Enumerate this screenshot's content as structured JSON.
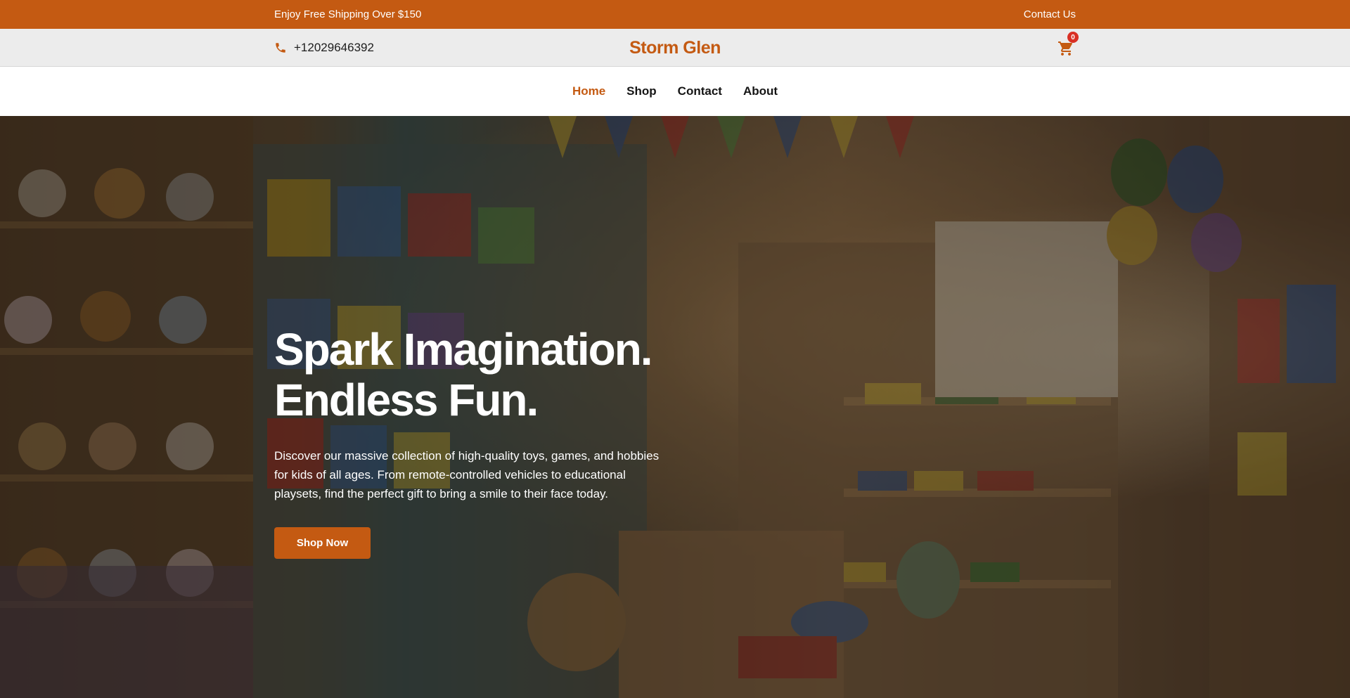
{
  "topbar": {
    "promo_text": "Enjoy Free Shipping Over $150",
    "contact_link": "Contact Us"
  },
  "header": {
    "phone": "+12029646392",
    "brand": "Storm Glen",
    "cart_count": "0"
  },
  "nav": {
    "items": [
      {
        "label": "Home",
        "active": true
      },
      {
        "label": "Shop",
        "active": false
      },
      {
        "label": "Contact",
        "active": false
      },
      {
        "label": "About",
        "active": false
      }
    ]
  },
  "hero": {
    "title_line1": "Spark Imagination.",
    "title_line2": "Endless Fun.",
    "description": "Discover our massive collection of high-quality toys, games, and hobbies for kids of all ages. From remote-controlled vehicles to educational playsets, find the perfect gift to bring a smile to their face today.",
    "cta_label": "Shop Now"
  },
  "colors": {
    "accent": "#c45a12",
    "badge": "#d93025"
  },
  "icons": {
    "phone": "phone-icon",
    "cart": "cart-icon"
  }
}
